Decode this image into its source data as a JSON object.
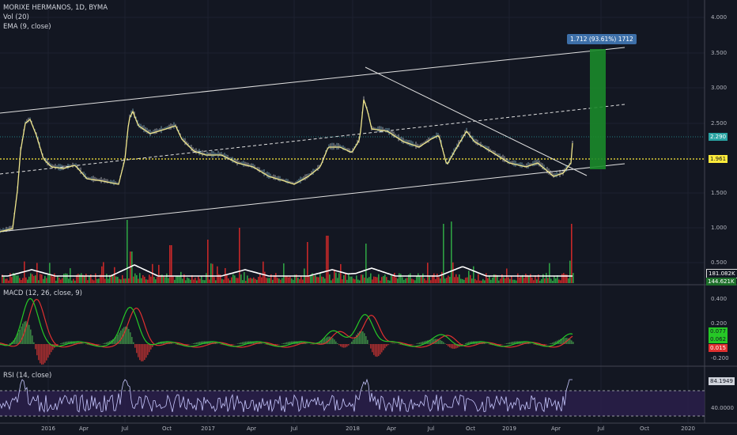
{
  "header": {
    "symbol": "MORIXE HERMANOS, 1D, BYMA",
    "vol": "Vol (20)",
    "ema": "EMA (9, close)"
  },
  "panes": {
    "macd_label": "MACD (12, 26, close, 9)",
    "rsi_label": "RSI (14, close)"
  },
  "price_axis": [
    "4.000",
    "3.500",
    "3.000",
    "2.500",
    "1.500",
    "1.000",
    "0.500"
  ],
  "macd_axis": [
    "0.400",
    "0.200",
    "-0.200"
  ],
  "rsi_axis": [
    "40.0000"
  ],
  "time_axis": [
    "2016",
    "Apr",
    "Jul",
    "Oct",
    "2017",
    "Apr",
    "Jul",
    "2018",
    "Apr",
    "Jul",
    "Oct",
    "2019",
    "Apr",
    "Jul",
    "Oct",
    "2020"
  ],
  "badges": {
    "price_last": "2.290",
    "price_level": "1.961",
    "vol_1": "181.082K",
    "vol_2": "144.621K",
    "macd_1": "0.077",
    "macd_2": "0.062",
    "macd_3": "0.015",
    "rsi": "84.1949"
  },
  "measure_callout": "1.712 (93.61%) 1712",
  "colors": {
    "background": "#131722",
    "price_line": "#f0e68c",
    "macd_line": "#26c826",
    "signal_line": "#e03030",
    "level_line": "#ffeb3b",
    "rsi_line": "#c8c8ff",
    "target_box": "#1b8a2a"
  }
}
